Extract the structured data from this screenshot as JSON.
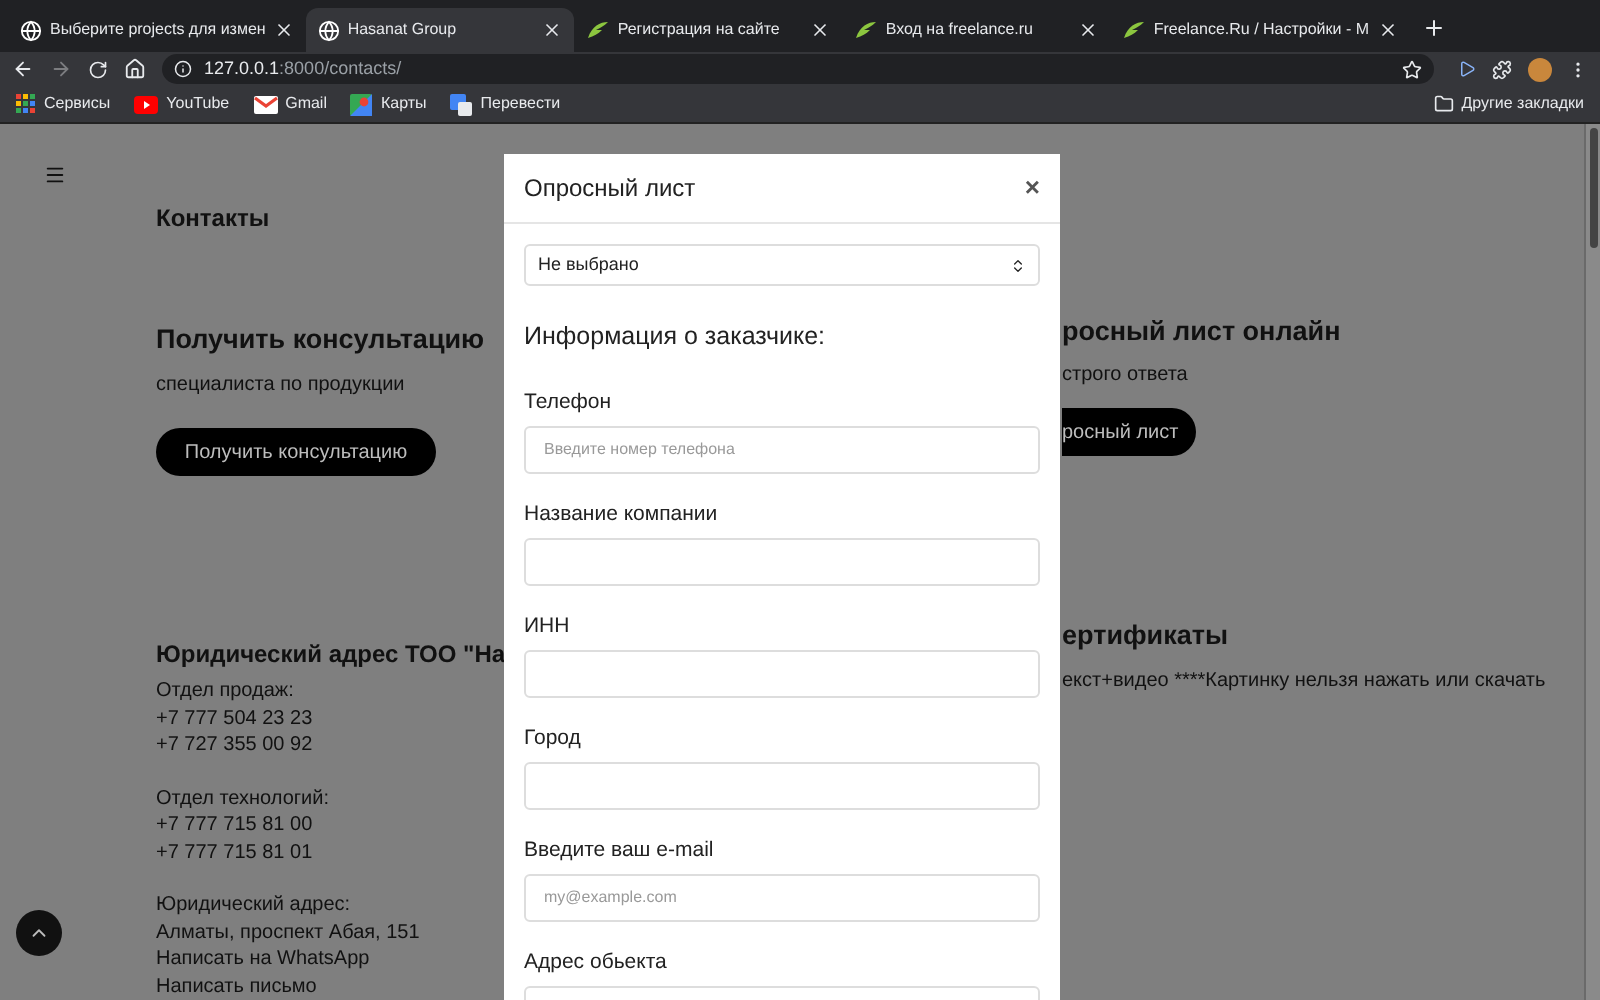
{
  "browser": {
    "tabs": [
      {
        "title": "Выберите projects для измен",
        "kind": "globe",
        "selected": false
      },
      {
        "title": "Hasanat Group",
        "kind": "globe",
        "selected": true
      },
      {
        "title": "Регистрация на сайте",
        "kind": "freelance",
        "selected": false
      },
      {
        "title": "Вход на freelance.ru",
        "kind": "freelance",
        "selected": false
      },
      {
        "title": "Freelance.Ru / Настройки - М",
        "kind": "freelance",
        "selected": false
      }
    ],
    "address": {
      "host": "127.0.0.1",
      "path": ":8000/contacts/"
    },
    "bookmarks": [
      {
        "label": "Сервисы",
        "kind": "apps"
      },
      {
        "label": "YouTube",
        "kind": "youtube"
      },
      {
        "label": "Gmail",
        "kind": "gmail"
      },
      {
        "label": "Карты",
        "kind": "maps"
      },
      {
        "label": "Перевести",
        "kind": "translate"
      }
    ],
    "other_bookmarks": "Другие закладки"
  },
  "page": {
    "title": "Контакты",
    "consult": {
      "title": "Получить консультацию",
      "subtitle": "специалиста по продукции",
      "button": "Получить консультацию"
    },
    "legal": {
      "title": "Юридический адрес ТОО \"На",
      "groups": [
        [
          "Отдел продаж:",
          "+7 777 504 23 23",
          "+7 727 355 00 92"
        ],
        [
          "Отдел технологий:",
          "+7 777 715 81 00",
          "+7 777 715 81 01"
        ],
        [
          "Юридический адрес:",
          "Алматы, проспект Абая, 151",
          "Написать на WhatsApp",
          "Написать письмо"
        ]
      ]
    },
    "survey": {
      "title": "росный лист онлайн",
      "subtitle": "строго ответа",
      "button": "росный лист"
    },
    "certificates": {
      "title": "ертификаты",
      "text": "екст+видео ****Картинку нельзя нажать или скачать"
    }
  },
  "modal": {
    "title": "Опросный лист",
    "close": "×",
    "select": "Не выбрано",
    "section": "Информация о заказчике:",
    "fields": [
      {
        "label": "Телефон",
        "placeholder": "Введите номер телефона"
      },
      {
        "label": "Название компании"
      },
      {
        "label": "ИНН"
      },
      {
        "label": "Город"
      },
      {
        "label": "Введите ваш e-mail",
        "placeholder": "my@example.com"
      },
      {
        "label": "Адрес обьекта"
      }
    ]
  }
}
